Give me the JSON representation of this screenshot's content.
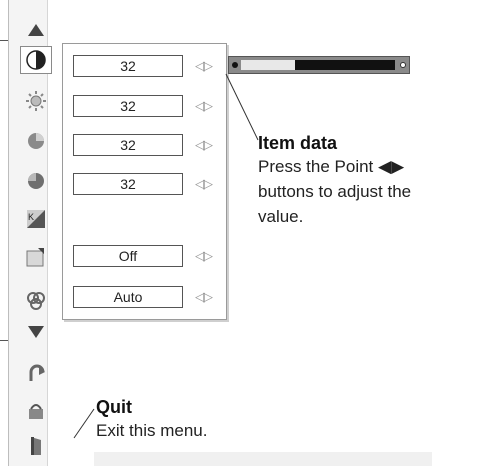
{
  "icons": {
    "top_arrow": "up-triangle-icon",
    "items": [
      "contrast-icon",
      "brightness-icon",
      "color-icon",
      "tint-icon",
      "color-temp-icon",
      "white-balance-icon",
      "sharpness-icon"
    ],
    "down_arrow": "down-triangle-icon",
    "bottom": [
      "reset-icon",
      "store-icon",
      "quit-icon"
    ]
  },
  "menu": {
    "rows": [
      {
        "value": "32"
      },
      {
        "value": "32"
      },
      {
        "value": "32"
      },
      {
        "value": "32"
      },
      {
        "value": "Off"
      },
      {
        "value": "Auto"
      }
    ],
    "slider_level": 0.35
  },
  "callouts": {
    "item_data": {
      "title": "Item data",
      "line1": "Press the Point ◀▶",
      "line2": "buttons to adjust the",
      "line3": "value."
    },
    "quit": {
      "title": "Quit",
      "text": "Exit this menu."
    }
  },
  "colors": {
    "panel_bg": "#f4f4f4",
    "slider_dark": "#111111",
    "arrow_gray": "#9a9a9a"
  }
}
